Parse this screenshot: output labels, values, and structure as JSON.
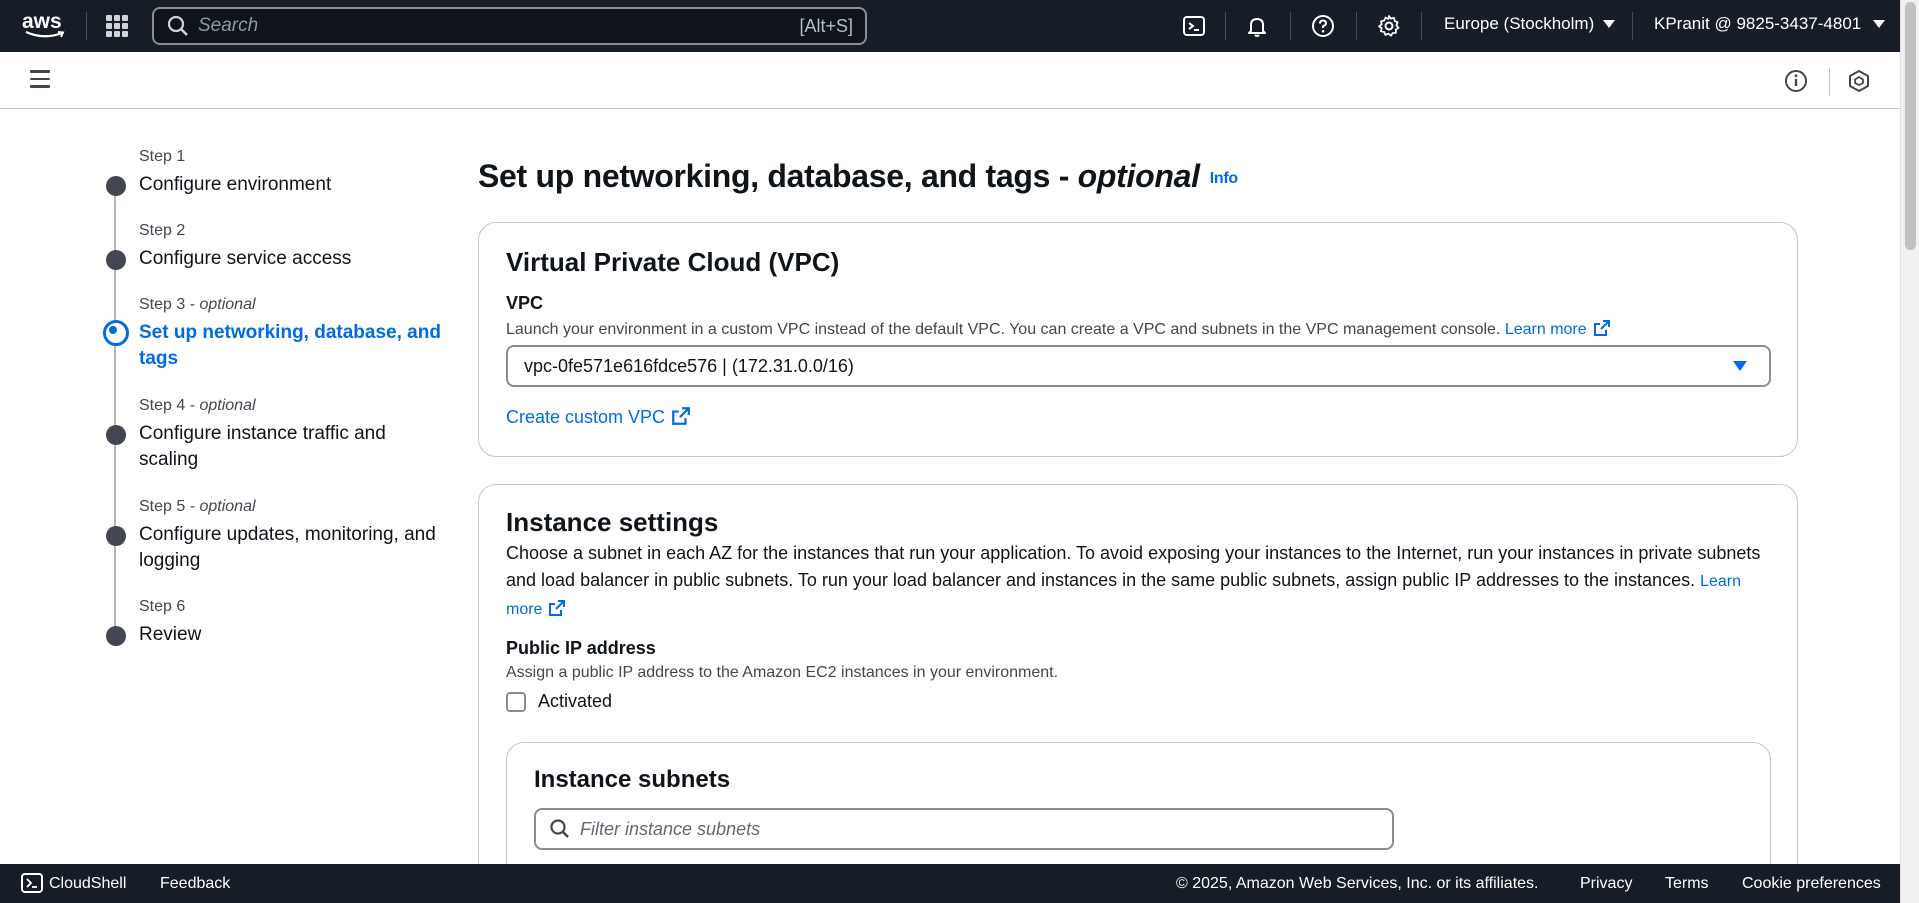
{
  "topnav": {
    "logo_text": "aws",
    "search_placeholder": "Search",
    "search_shortcut": "[Alt+S]",
    "region": "Europe (Stockholm)",
    "account": "KPranit @ 9825-3437-4801",
    "icons": [
      "services-grid-icon",
      "cloudshell-icon",
      "bell-icon",
      "help-icon",
      "gear-icon"
    ]
  },
  "steps": [
    {
      "num": "Step 1",
      "optional": "",
      "title": "Configure environment",
      "active": false
    },
    {
      "num": "Step 2",
      "optional": "",
      "title": "Configure service access",
      "active": false
    },
    {
      "num": "Step 3 - ",
      "optional": "optional",
      "title": "Set up networking, database, and tags",
      "active": true
    },
    {
      "num": "Step 4 - ",
      "optional": "optional",
      "title": "Configure instance traffic and scaling",
      "active": false
    },
    {
      "num": "Step 5 - ",
      "optional": "optional",
      "title": "Configure updates, monitoring, and logging",
      "active": false
    },
    {
      "num": "Step 6",
      "optional": "",
      "title": "Review",
      "active": false
    }
  ],
  "main": {
    "title": "Set up networking, database, and tags - ",
    "title_optional": "optional",
    "info_label": "Info"
  },
  "vpc_card": {
    "heading": "Virtual Private Cloud (VPC)",
    "label": "VPC",
    "description": "Launch your environment in a custom VPC instead of the default VPC. You can create a VPC and subnets in the VPC management console.",
    "learn_more": "Learn more",
    "selected_vpc": "vpc-0fe571e616fdce576 | (172.31.0.0/16)",
    "create_link": "Create custom VPC"
  },
  "instance_card": {
    "heading": "Instance settings",
    "description": "Choose a subnet in each AZ for the instances that run your application. To avoid exposing your instances to the Internet, run your instances in private subnets and load balancer in public subnets. To run your load balancer and instances in the same public subnets, assign public IP addresses to the instances.",
    "learn_more": "Learn more",
    "public_ip_label": "Public IP address",
    "public_ip_desc": "Assign a public IP address to the Amazon EC2 instances in your environment.",
    "activated_label": "Activated",
    "activated_checked": false,
    "subnets_heading": "Instance subnets",
    "filter_placeholder": "Filter instance subnets"
  },
  "footer": {
    "cloudshell": "CloudShell",
    "feedback": "Feedback",
    "copyright": "© 2025, Amazon Web Services, Inc. or its affiliates.",
    "privacy": "Privacy",
    "terms": "Terms",
    "cookie": "Cookie preferences"
  }
}
